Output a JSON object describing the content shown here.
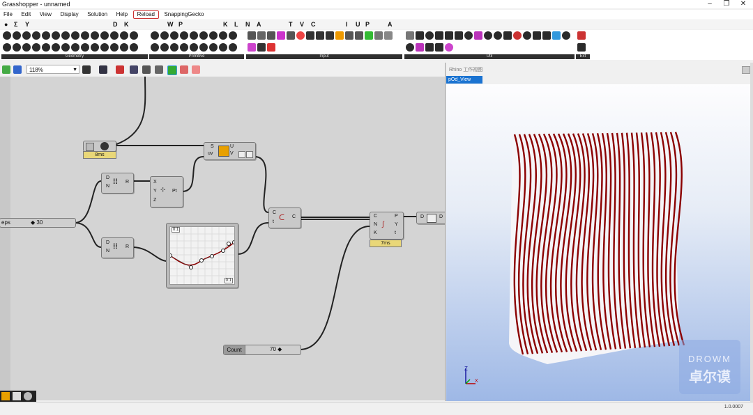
{
  "window": {
    "title": "Grasshopper - unnamed",
    "document": "unnamed"
  },
  "menu": [
    "File",
    "Edit",
    "View",
    "Display",
    "Solution",
    "Help",
    "Reload",
    "SnappingGecko"
  ],
  "letters": [
    "Σ",
    "Y",
    "D",
    "K",
    "W",
    "P",
    "K",
    "L",
    "N",
    "A",
    "T",
    "V",
    "C",
    "I",
    "U",
    "P",
    "A"
  ],
  "palettes": [
    {
      "label": "Geometry",
      "tools": 28
    },
    {
      "label": "Primitive",
      "tools": 18
    },
    {
      "label": "Input",
      "tools": 18
    },
    {
      "label": "Util",
      "tools": 22
    },
    {
      "label": "Ext",
      "tools": 4
    }
  ],
  "canvas_toolbar": {
    "zoom": "118%"
  },
  "nodes": {
    "timer": {
      "badge": "8ms"
    },
    "sdl": {
      "in": [
        "S",
        "uv"
      ],
      "out": [
        "U",
        "V"
      ]
    },
    "div1": {
      "in": [
        "D",
        "N"
      ],
      "out": "R"
    },
    "div2": {
      "in": [
        "D",
        "N"
      ],
      "out": "R"
    },
    "vec": {
      "in": [
        "X",
        "Y",
        "Z"
      ],
      "out": "Pt"
    },
    "graph": {
      "corner_tl": "0:1",
      "corner_br": "0:1"
    },
    "crv": {
      "in": [
        "C",
        "t"
      ],
      "out": "C"
    },
    "contour": {
      "in": [
        "C",
        "N",
        "K"
      ],
      "out": [
        "P",
        "Y",
        "t"
      ],
      "badge": "7ms"
    },
    "data": {
      "in": "D",
      "out": "D"
    }
  },
  "sliders": {
    "steps": {
      "label": "eps",
      "value": "◆ 30"
    },
    "count": {
      "label": "Count",
      "value": "70 ◆"
    }
  },
  "rhino": {
    "title": "Rhino 工作视图",
    "view_tab": "pOd_View",
    "axis_z": "Z",
    "axis_x": "X"
  },
  "watermark": {
    "line1": "DROWM",
    "line2": "卓尔谟"
  },
  "status": {
    "version": "1.0.0007"
  },
  "colors": {
    "accent": "#1a73d1",
    "curve": "#8b0000",
    "wire": "#222222"
  }
}
